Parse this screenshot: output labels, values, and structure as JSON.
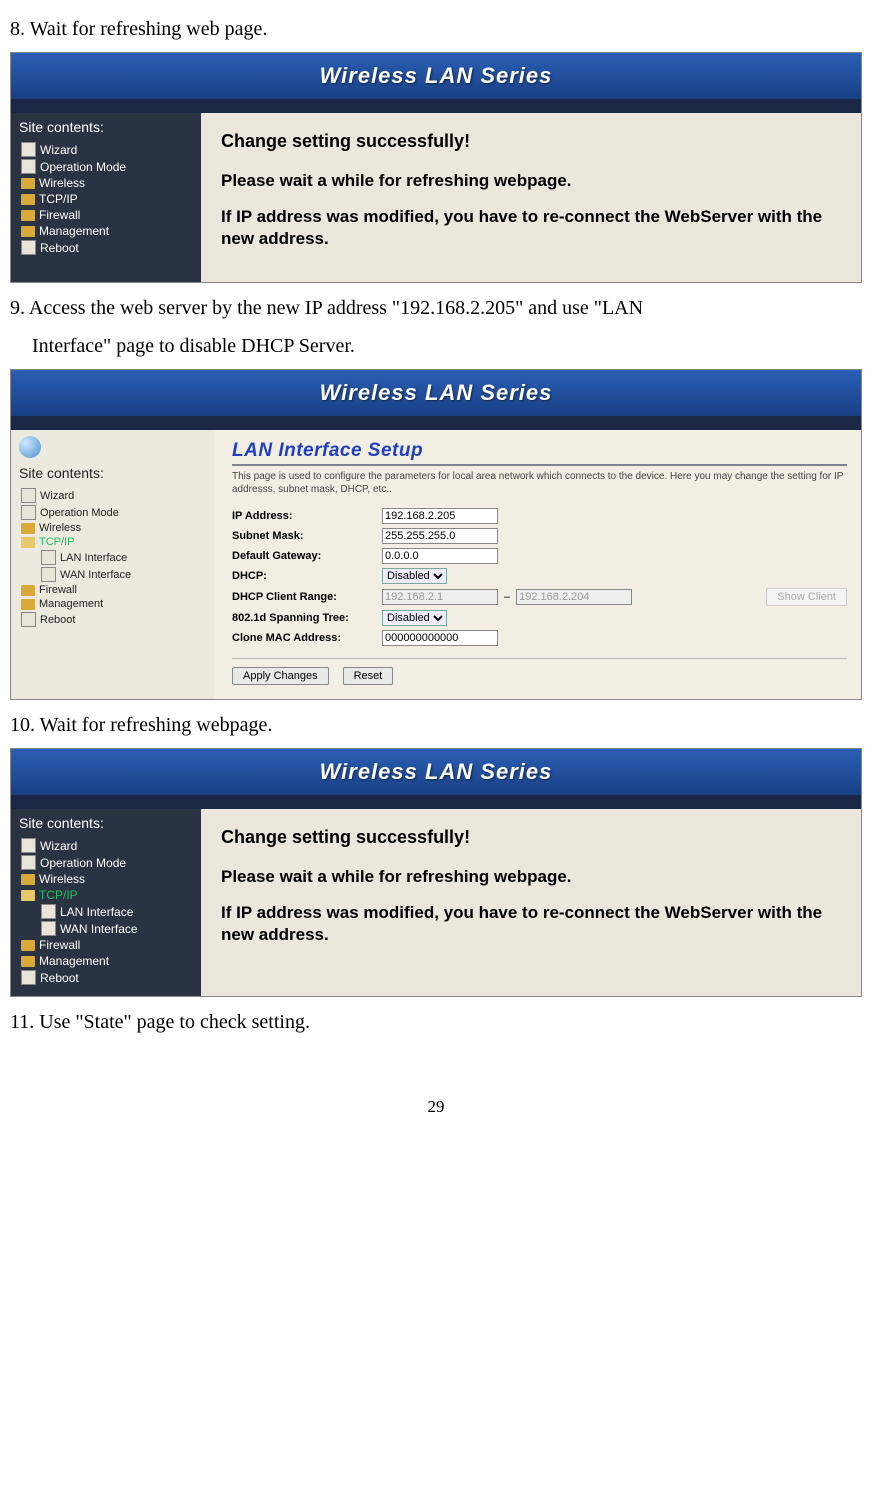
{
  "step8": "8. Wait for refreshing web page.",
  "step9a": "9. Access the web server by the new IP address \"192.168.2.205\" and use \"LAN",
  "step9b": "Interface\" page to disable DHCP Server.",
  "step10": "10. Wait for refreshing webpage.",
  "step11": "11. Use \"State\" page to check setting.",
  "pageNum": "29",
  "brand": "Wireless LAN Series",
  "sidebar": {
    "title": "Site contents:",
    "wizard": "Wizard",
    "opmode": "Operation Mode",
    "wireless": "Wireless",
    "tcpip": "TCP/IP",
    "lanif": "LAN Interface",
    "wanif": "WAN Interface",
    "firewall": "Firewall",
    "management": "Management",
    "reboot": "Reboot"
  },
  "success": {
    "title": "Change setting successfully!",
    "wait": "Please wait a while for refreshing webpage.",
    "ipnote": "If IP address was modified, you have to re-connect the WebServer with the new address."
  },
  "lan": {
    "title": "LAN Interface Setup",
    "desc": "This page is used to configure the parameters for local area network which connects to the device. Here you may change the setting for IP addresss, subnet mask, DHCP, etc..",
    "ipLabel": "IP Address:",
    "ip": "192.168.2.205",
    "maskLabel": "Subnet Mask:",
    "mask": "255.255.255.0",
    "gwLabel": "Default Gateway:",
    "gw": "0.0.0.0",
    "dhcpLabel": "DHCP:",
    "dhcp": "Disabled",
    "rangeLabel": "DHCP Client Range:",
    "rangeA": "192.168.2.1",
    "rangeB": "192.168.2.204",
    "showClient": "Show Client",
    "spanLabel": "802.1d Spanning Tree:",
    "span": "Disabled",
    "cloneLabel": "Clone MAC Address:",
    "clone": "000000000000",
    "apply": "Apply Changes",
    "reset": "Reset"
  }
}
